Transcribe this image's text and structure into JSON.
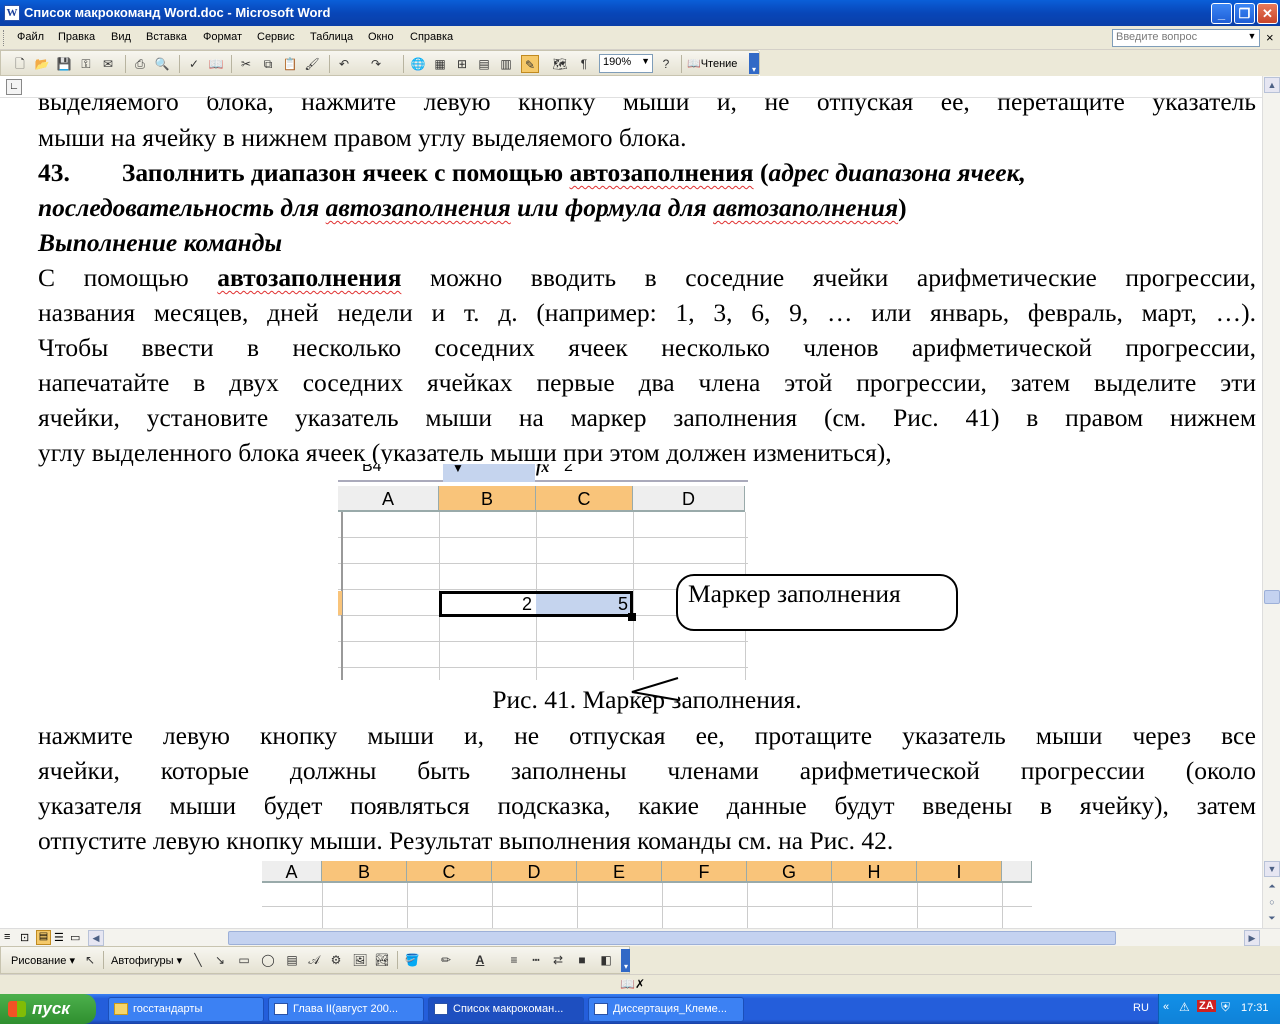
{
  "window": {
    "title": "Список макрокоманд Word.doc - Microsoft Word",
    "app_icon": "W"
  },
  "menu": {
    "items": [
      "Файл",
      "Правка",
      "Вид",
      "Вставка",
      "Формат",
      "Сервис",
      "Таблица",
      "Окно",
      "Справка"
    ],
    "help_placeholder": "Введите вопрос"
  },
  "toolbar": {
    "zoom": "190%",
    "reading": "Чтение"
  },
  "document": {
    "lines": [
      "выделяемого блока, нажмите левую кнопку мыши и, не отпуская ее, перетащите указатель",
      "мыши на ячейку в нижнем правом углу выделяемого блока."
    ],
    "heading": {
      "number": "43.",
      "text_pre": "Заполнить диапазон ячеек с помощью ",
      "word1": "автозаполнения",
      "paren_open": " (",
      "italic1": "адрес диапазона ячеек,",
      "line2_pre": "последовательность для ",
      "word2": "автозаполнения",
      "line2_mid": " или формула для ",
      "word3": "автозаполнения",
      "paren_close": ")"
    },
    "subheading": "Выполнение команды",
    "para1": {
      "l1_pre": "С помощью ",
      "l1_bold": "автозаполнения",
      "l1_post": " можно вводить в соседние ячейки арифметические прогрессии,",
      "l2": "названия месяцев, дней недели и т. д. (например: 1, 3, 6, 9, … или январь, февраль, март, …).",
      "l3": "Чтобы ввести в несколько соседних ячеек несколько членов арифметической прогрессии,",
      "l4": "напечатайте в двух соседних ячейках первые два члена этой прогрессии, затем выделите эти",
      "l5": "ячейки, установите указатель мыши на маркер заполнения (см. Рис. 41) в правом нижнем",
      "l6": "углу выделенного блока ячеек (указатель мыши при этом должен измениться),"
    },
    "fig41": {
      "namebox": "B4",
      "fx": "fx",
      "formula": "2",
      "cols": [
        "A",
        "B",
        "C",
        "D"
      ],
      "cell_b": "2",
      "cell_c": "5",
      "callout": "Маркер заполнения",
      "caption": "Рис. 41. Маркер заполнения."
    },
    "para2": {
      "l1": "нажмите левую кнопку мыши и, не отпуская ее, протащите указатель мыши через все",
      "l2": "ячейки, которые должны быть заполнены членами арифметической прогрессии (около",
      "l3": "указателя мыши будет появляться подсказка, какие данные будут введены в ячейку), затем",
      "l4": "отпустите левую кнопку мыши. Результат выполнения команды см. на Рис. 42."
    },
    "fig42": {
      "cols": [
        "A",
        "B",
        "C",
        "D",
        "E",
        "F",
        "G",
        "H",
        "I"
      ]
    }
  },
  "drawing": {
    "draw_label": "Рисование",
    "autoshapes_label": "Автофигуры"
  },
  "taskbar": {
    "start": "пуск",
    "tasks": [
      "госстандарты",
      "Глава II(август 200...",
      "Список макрокоман...",
      "Диссертация_Клеме..."
    ],
    "lang": "RU",
    "clock": "17:31"
  }
}
